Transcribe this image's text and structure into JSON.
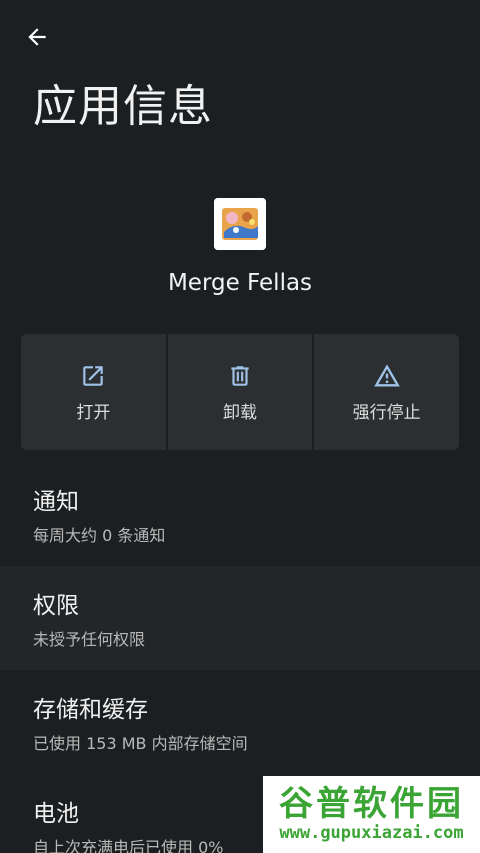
{
  "header": {
    "title": "应用信息"
  },
  "app": {
    "name": "Merge Fellas"
  },
  "actions": [
    {
      "label": "打开",
      "icon": "open-external-icon"
    },
    {
      "label": "卸载",
      "icon": "trash-icon"
    },
    {
      "label": "强行停止",
      "icon": "warning-icon"
    }
  ],
  "settings": [
    {
      "title": "通知",
      "summary": "每周大约 0 条通知"
    },
    {
      "title": "权限",
      "summary": "未授予任何权限"
    },
    {
      "title": "存储和缓存",
      "summary": "已使用 153 MB 内部存储空间"
    },
    {
      "title": "电池",
      "summary": "自上次充满电后已使用 0%"
    }
  ],
  "watermark": {
    "text": "谷普软件园",
    "url": "www.gupuxiazai.com"
  },
  "colors": {
    "background": "#1c1f21",
    "button": "#2b2f31",
    "watermark_green": "#3aa534"
  }
}
